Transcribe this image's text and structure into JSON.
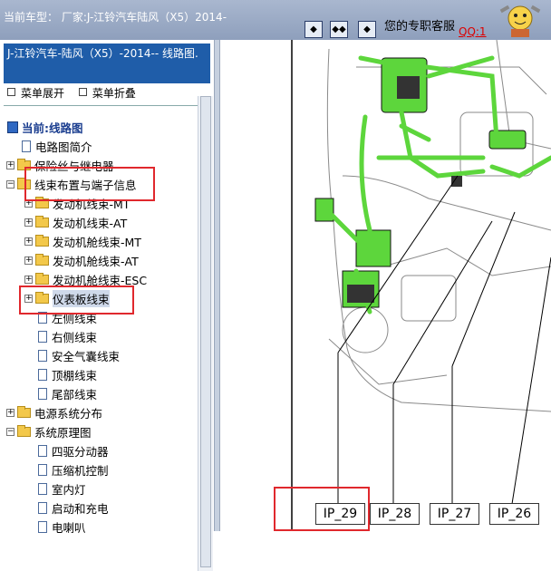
{
  "header": {
    "title": "当前车型：  厂家:J-江铃汽车陆风（X5）2014-",
    "service_text": "您的专职客服",
    "qq_link": "QQ:1",
    "tool_buttons": [
      "◆",
      "◆◆",
      "◆"
    ]
  },
  "sidebar": {
    "vehicle_title": "J-江铃汽车-陆风（X5）-2014-- 线路图.",
    "expand_label": "菜单展开",
    "collapse_label": "菜单折叠",
    "tree": [
      {
        "label": "当前:线路图"
      },
      {
        "label": "电路图简介"
      },
      {
        "label": "保险丝与继电器"
      },
      {
        "label": "线束布置与端子信息"
      },
      {
        "label": "发动机线束-MT"
      },
      {
        "label": "发动机线束-AT"
      },
      {
        "label": "发动机舱线束-MT"
      },
      {
        "label": "发动机舱线束-AT"
      },
      {
        "label": "发动机舱线束-ESC"
      },
      {
        "label": "仪表板线束"
      },
      {
        "label": "左侧线束"
      },
      {
        "label": "右侧线束"
      },
      {
        "label": "安全气囊线束"
      },
      {
        "label": "顶棚线束"
      },
      {
        "label": "尾部线束"
      },
      {
        "label": "电源系统分布"
      },
      {
        "label": "系统原理图"
      },
      {
        "label": "四驱分动器"
      },
      {
        "label": "压缩机控制"
      },
      {
        "label": "室内灯"
      },
      {
        "label": "启动和充电"
      },
      {
        "label": "电喇叭"
      }
    ]
  },
  "diagram": {
    "connectors": [
      "IP_29",
      "IP_28",
      "IP_27",
      "IP_26"
    ],
    "colors": {
      "harness": "#5dd63c",
      "highlight": "#e0282d",
      "selected_bg": "#cfd9ea"
    }
  }
}
